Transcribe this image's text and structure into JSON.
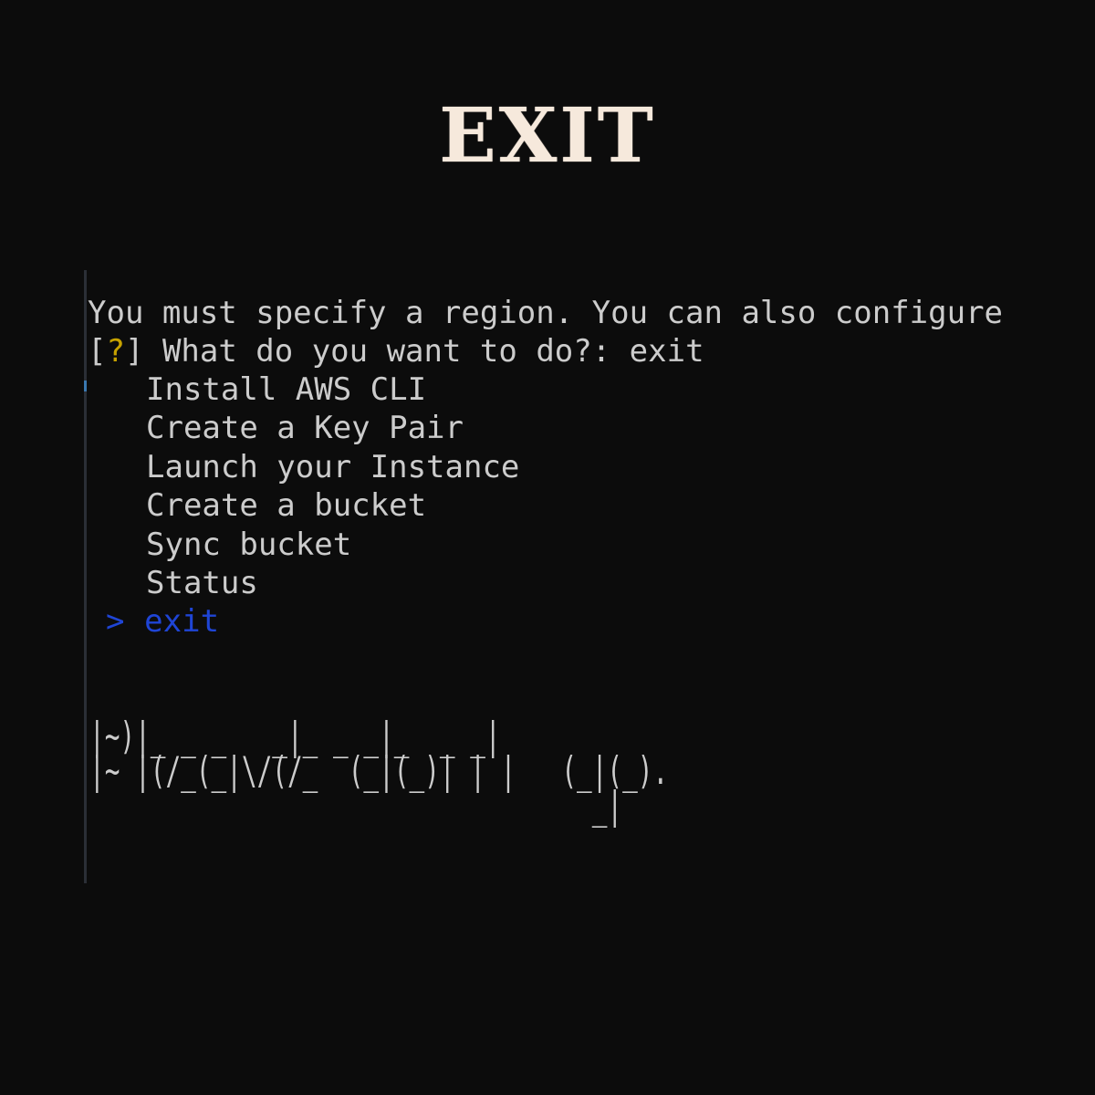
{
  "heading": "EXIT",
  "terminal": {
    "lines": [
      "You must specify a region. You can also configure",
      "What do you want to do?: exit"
    ],
    "prompt_open": "[",
    "prompt_mark": "?",
    "prompt_close": "]",
    "menu": {
      "cursor": ">",
      "options": [
        "Install AWS CLI",
        "Create a Key Pair",
        "Launch your Instance",
        "Create a bucket",
        "Sync bucket",
        "Status",
        "exit"
      ],
      "selected": "exit"
    },
    "ascii_art": [
      "|~)|_ _ _   _|_ _ _|_  _ _|",
      "|~ |(/_(_|\\/(/_  (_|(_)| | |   (_|(_).",
      "                                 _|"
    ]
  },
  "colors": {
    "background": "#0c0c0c",
    "heading": "#f6e9dc",
    "text": "#cccccc",
    "prompt_mark": "#c7a200",
    "selected": "#1f45d6"
  }
}
